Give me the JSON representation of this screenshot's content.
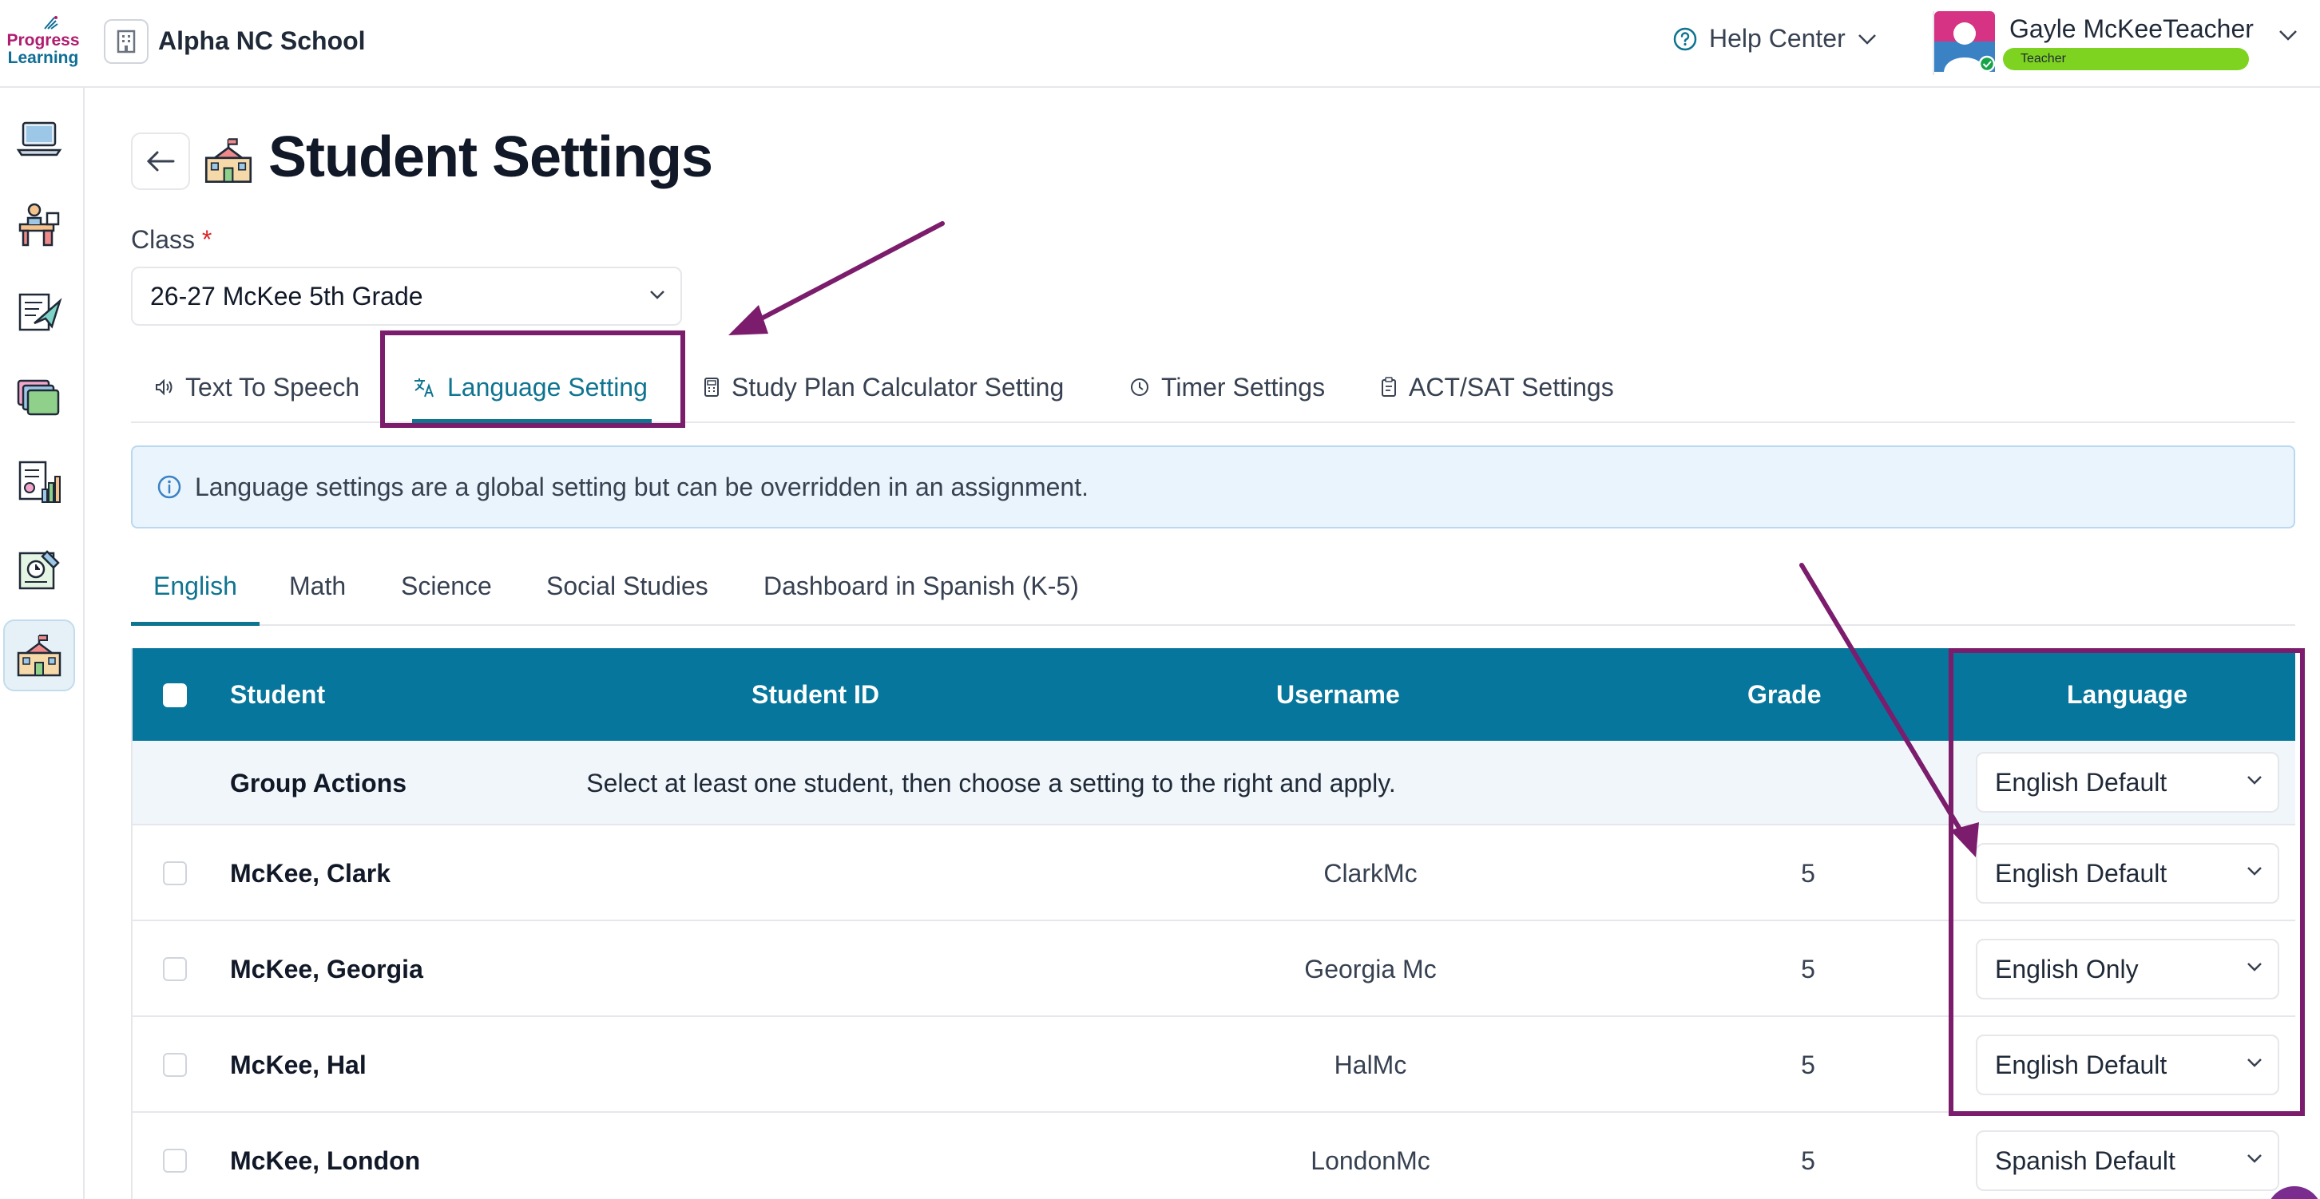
{
  "topbar": {
    "logo_line1": "Progress",
    "logo_line2": "Learning",
    "school_name": "Alpha NC School",
    "help_label": "Help Center",
    "user_name": "Gayle McKeeTeacher",
    "user_role": "Teacher"
  },
  "sidebar": {
    "icons": [
      "laptop-icon",
      "teacher-desk-icon",
      "assignment-icon",
      "folders-icon",
      "reports-icon",
      "lesson-planner-icon",
      "school-icon"
    ],
    "active_index": 6
  },
  "page": {
    "title": "Student Settings",
    "class_label": "Class",
    "required_mark": "*",
    "class_value": "26-27 McKee 5th Grade"
  },
  "settings_tabs": [
    {
      "label": "Text To Speech",
      "icon": "speaker-icon"
    },
    {
      "label": "Language Setting",
      "icon": "translate-icon",
      "active": true
    },
    {
      "label": "Study Plan Calculator Setting",
      "icon": "calculator-icon"
    },
    {
      "label": "Timer Settings",
      "icon": "clock-icon"
    },
    {
      "label": "ACT/SAT Settings",
      "icon": "clipboard-icon"
    }
  ],
  "info_message": "Language settings are a global setting but can be overridden in an assignment.",
  "subject_tabs": [
    {
      "label": "English",
      "active": true
    },
    {
      "label": "Math"
    },
    {
      "label": "Science"
    },
    {
      "label": "Social Studies"
    },
    {
      "label": "Dashboard in Spanish (K-5)"
    }
  ],
  "table": {
    "headers": {
      "student": "Student",
      "student_id": "Student ID",
      "username": "Username",
      "grade": "Grade",
      "language": "Language"
    },
    "group_actions": {
      "label": "Group Actions",
      "message": "Select at least one student, then choose a setting to the right and apply.",
      "language": "English Default"
    },
    "rows": [
      {
        "student": "McKee, Clark",
        "username": "ClarkMc",
        "grade": "5",
        "language": "English Default"
      },
      {
        "student": "McKee, Georgia",
        "username": "Georgia Mc",
        "grade": "5",
        "language": "English Only"
      },
      {
        "student": "McKee, Hal",
        "username": "HalMc",
        "grade": "5",
        "language": "English Default"
      },
      {
        "student": "McKee, London",
        "username": "LondonMc",
        "grade": "5",
        "language": "Spanish Default"
      }
    ]
  },
  "colors": {
    "brand_teal": "#06769c",
    "active_tab": "#0e7490",
    "annotation": "#7b1d6c",
    "badge_green": "#7ed321"
  }
}
